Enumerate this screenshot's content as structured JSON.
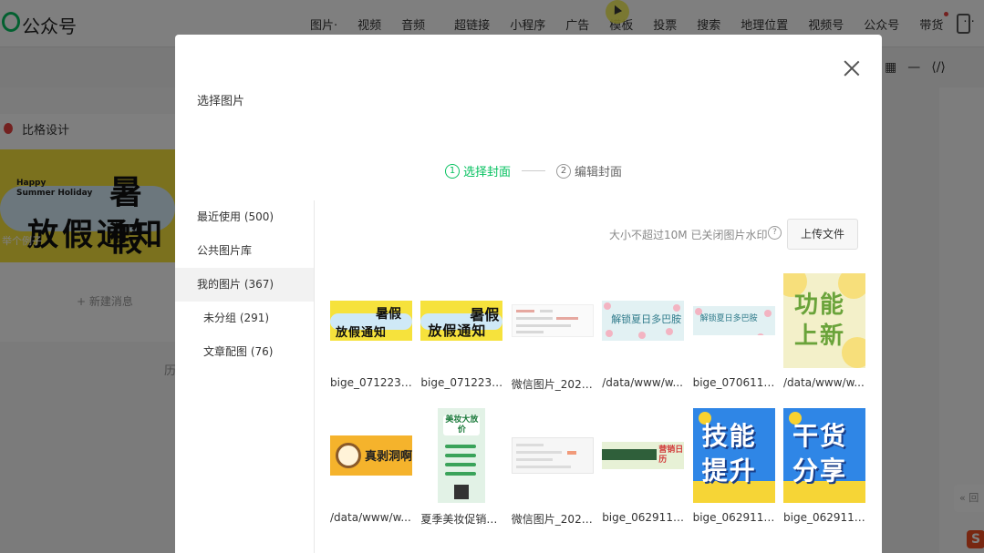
{
  "app": {
    "name": "公众号",
    "toolbar": [
      "图片·",
      "视频",
      "音频",
      "超链接",
      "小程序",
      "广告",
      "模板",
      "投票",
      "搜索",
      "地理位置",
      "视频号",
      "公众号",
      "带货",
      "···"
    ],
    "editor_tools": [
      "▦",
      "—",
      "⟨/⟩"
    ],
    "brand": "比格设计",
    "banner": {
      "small": "Happy\nSummer Holiday",
      "line1": "暑假",
      "line2": "放假通知",
      "caption": "举个例子"
    },
    "new_message": "+ 新建消息",
    "history": "历",
    "back_top": "« 回",
    "sogou": "S"
  },
  "dialog": {
    "title": "选择图片",
    "steps": [
      {
        "num": "1",
        "label": "选择封面"
      },
      {
        "num": "2",
        "label": "编辑封面"
      }
    ],
    "categories": [
      {
        "label": "最近使用 (500)",
        "sub": false,
        "active": false
      },
      {
        "label": "公共图片库",
        "sub": false,
        "active": false
      },
      {
        "label": "我的图片 (367)",
        "sub": false,
        "active": true
      },
      {
        "label": "未分组 (291)",
        "sub": true,
        "active": false
      },
      {
        "label": "文章配图 (76)",
        "sub": true,
        "active": false
      }
    ],
    "hint": "大小不超过10M 已关闭图片水印",
    "help_icon": "?",
    "upload": "上传文件",
    "images": [
      {
        "caption": "bige_0712235...",
        "kind": "holiday",
        "text1": "暑假",
        "text2": "放假通知"
      },
      {
        "caption": "bige_0712235...",
        "kind": "holiday2",
        "text1": "暑假",
        "text2": "放假通知"
      },
      {
        "caption": "微信图片_2023...",
        "kind": "doc"
      },
      {
        "caption": "/data/www/w...",
        "kind": "flower",
        "text": "解锁夏日多巴胺"
      },
      {
        "caption": "bige_0706113...",
        "kind": "flower2",
        "text": "解锁夏日多巴胺"
      },
      {
        "caption": "/data/www/w...",
        "kind": "func",
        "text": "功能上新"
      },
      {
        "caption": "/data/www/w...",
        "kind": "coffee",
        "text": "真剥洞啊"
      },
      {
        "caption": "夏季美妆促销福...",
        "kind": "poster",
        "text": "美妆大放价"
      },
      {
        "caption": "微信图片_2023...",
        "kind": "shot"
      },
      {
        "caption": "bige_0629115...",
        "kind": "green",
        "text": "营销日历"
      },
      {
        "caption": "bige_0629114...",
        "kind": "big",
        "text": "技能提升"
      },
      {
        "caption": "bige_0629114...",
        "kind": "big",
        "text": "干货分享"
      }
    ]
  }
}
